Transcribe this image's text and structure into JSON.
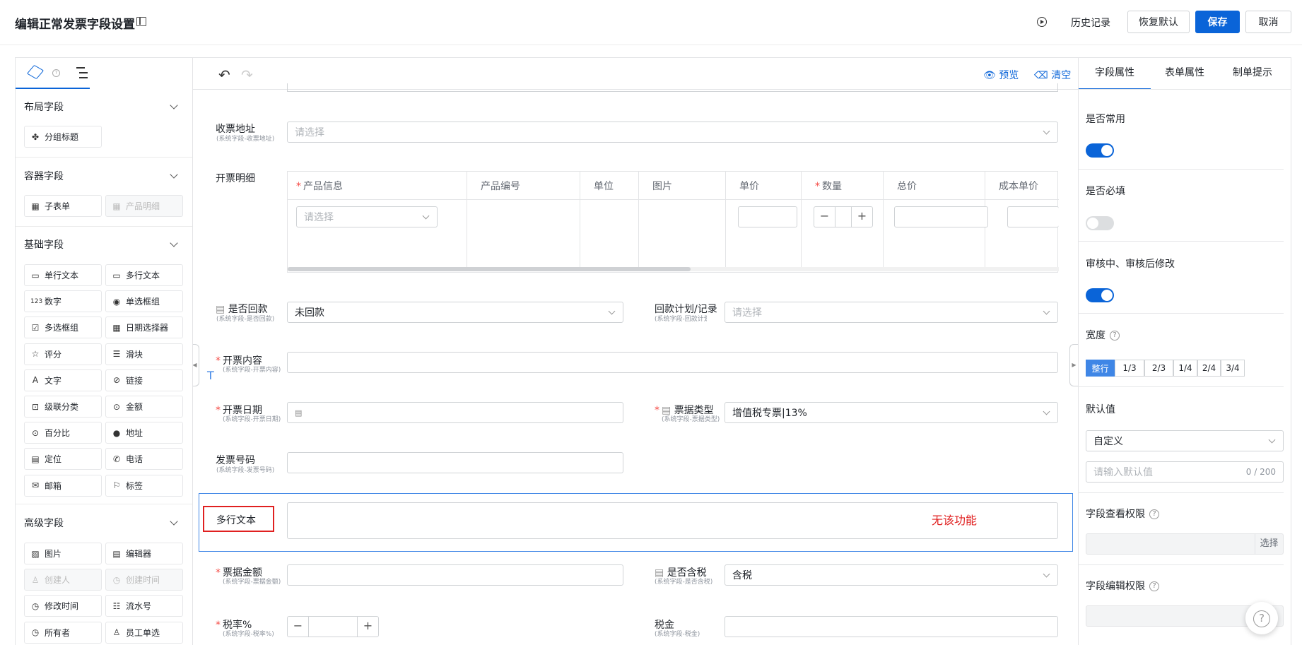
{
  "header": {
    "title": "编辑正常发票字段设置",
    "history": "历史记录",
    "restore": "恢复默认",
    "save": "保存",
    "cancel": "取消"
  },
  "left": {
    "sections": {
      "layout": "布局字段",
      "container": "容器字段",
      "basic": "基础字段",
      "advanced": "高级字段"
    },
    "layout_items": [
      "分组标题"
    ],
    "container_items": [
      "子表单",
      "产品明细"
    ],
    "basic_items": [
      "单行文本",
      "多行文本",
      "数字",
      "单选框组",
      "多选框组",
      "日期选择器",
      "评分",
      "滑块",
      "文字",
      "链接",
      "级联分类",
      "金额",
      "百分比",
      "地址",
      "定位",
      "电话",
      "邮箱",
      "标签"
    ],
    "advanced_items": [
      "图片",
      "编辑器",
      "创建人",
      "创建时间",
      "修改时间",
      "流水号",
      "所有者",
      "员工单选"
    ]
  },
  "center": {
    "preview": "预览",
    "clear": "清空",
    "address": {
      "label": "收票地址",
      "sub": "(系统字段-收票地址)",
      "placeholder": "请选择"
    },
    "detail": {
      "label": "开票明细",
      "columns": [
        "产品信息",
        "产品编号",
        "单位",
        "图片",
        "单价",
        "数量",
        "总价",
        "成本单价"
      ],
      "product_placeholder": "请选择"
    },
    "repaid": {
      "label": "是否回款",
      "sub": "(系统字段-是否回款)",
      "value": "未回款"
    },
    "plan": {
      "label": "回款计划/记录",
      "sub": "(系统字段-回款计划/记录)",
      "placeholder": "请选择"
    },
    "content": {
      "label": "开票内容",
      "sub": "(系统字段-开票内容)"
    },
    "date": {
      "label": "开票日期",
      "sub": "(系统字段-开票日期)"
    },
    "ticket_type": {
      "label": "票据类型",
      "sub": "(系统字段-票据类型)",
      "value": "增值税专票|13%"
    },
    "invoice_no": {
      "label": "发票号码",
      "sub": "(系统字段-发票号码)"
    },
    "multi": {
      "label": "多行文本",
      "note": "无该功能"
    },
    "amount": {
      "label": "票据金额",
      "sub": "(系统字段-票据金额)"
    },
    "tax_incl": {
      "label": "是否含税",
      "sub": "(系统字段-是否含税)",
      "value": "含税"
    },
    "rate": {
      "label": "税率%",
      "sub": "(系统字段-税率%)"
    },
    "tax": {
      "label": "税金",
      "sub": "(系统字段-税金)"
    }
  },
  "right": {
    "tabs": [
      "字段属性",
      "表单属性",
      "制单提示"
    ],
    "common": "是否常用",
    "required": "是否必填",
    "audit": "审核中、审核后修改",
    "width": "宽度",
    "width_options": [
      "整行",
      "1/3",
      "2/3",
      "1/4",
      "2/4",
      "3/4"
    ],
    "default_label": "默认值",
    "default_mode": "自定义",
    "default_placeholder": "请输入默认值",
    "default_count": "0 / 200",
    "view_perm": "字段查看权限",
    "select": "选择",
    "edit_perm": "字段编辑权限"
  },
  "colors": {
    "primary": "#0a64d8",
    "required": "#f54a45",
    "highlight": "#e02020"
  }
}
